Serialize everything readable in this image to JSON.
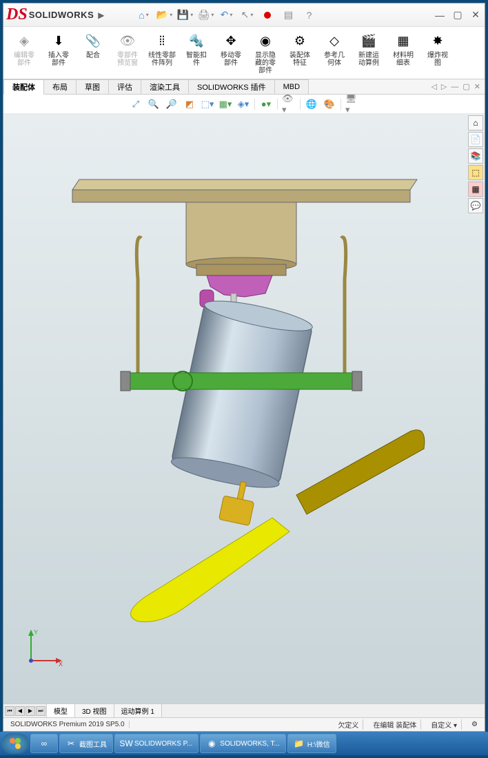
{
  "app": {
    "name": "SOLIDWORKS"
  },
  "ribbon": [
    {
      "id": "edit-part",
      "label": "编辑零\n部件",
      "disabled": true,
      "icon": "◈"
    },
    {
      "id": "insert-part",
      "label": "插入零\n部件",
      "icon": "⬇"
    },
    {
      "id": "mate",
      "label": "配合",
      "icon": "📎"
    },
    {
      "id": "preview",
      "label": "零部件\n预览窗",
      "disabled": true,
      "icon": "👁"
    },
    {
      "id": "pattern",
      "label": "线性零部\n件阵列",
      "icon": "⦙⦙"
    },
    {
      "id": "smart",
      "label": "智能扣\n件",
      "icon": "🔩"
    },
    {
      "id": "move",
      "label": "移动零\n部件",
      "icon": "✥"
    },
    {
      "id": "hide",
      "label": "显示隐\n藏的零\n部件",
      "icon": "◉"
    },
    {
      "id": "asmfeat",
      "label": "装配体\n特征",
      "icon": "⚙"
    },
    {
      "id": "refgeom",
      "label": "参考几\n何体",
      "icon": "◇"
    },
    {
      "id": "newmotion",
      "label": "新建运\n动算例",
      "icon": "🎬"
    },
    {
      "id": "bom",
      "label": "材料明\n细表",
      "icon": "▦"
    },
    {
      "id": "exploded",
      "label": "爆炸视\n图",
      "icon": "✸"
    }
  ],
  "tabs": [
    {
      "id": "assembly",
      "label": "装配体",
      "active": true
    },
    {
      "id": "layout",
      "label": "布局"
    },
    {
      "id": "sketch",
      "label": "草图"
    },
    {
      "id": "evaluate",
      "label": "评估"
    },
    {
      "id": "render",
      "label": "渲染工具"
    },
    {
      "id": "addin",
      "label": "SOLIDWORKS 插件"
    },
    {
      "id": "mbd",
      "label": "MBD"
    }
  ],
  "viewtabs": [
    {
      "id": "model",
      "label": "模型",
      "active": true
    },
    {
      "id": "3dview",
      "label": "3D 视图"
    },
    {
      "id": "motion1",
      "label": "运动算例 1"
    }
  ],
  "status": {
    "version": "SOLIDWORKS Premium 2019 SP5.0",
    "under": "欠定义",
    "editing": "在编辑 装配体",
    "custom": "自定义"
  },
  "taskbar": [
    {
      "id": "snip",
      "label": "截图工具",
      "icon": "✂"
    },
    {
      "id": "sw",
      "label": "SOLIDWORKS P...",
      "icon": "SW"
    },
    {
      "id": "swt",
      "label": "SOLIDWORKS, T...",
      "icon": "◉"
    },
    {
      "id": "wechat",
      "label": "H:\\微信",
      "icon": "📁"
    }
  ],
  "triad": {
    "x": "X",
    "y": "Y"
  },
  "chart_data": {
    "type": "3d-model",
    "description": "Mechanical assembly: ceiling-mounted propeller/fan unit",
    "parts": [
      {
        "name": "mounting-plate",
        "color": "#b8a878",
        "shape": "flat rectangular plate (top)"
      },
      {
        "name": "cylindrical-base",
        "color": "#c8b888",
        "shape": "short cylinder below plate"
      },
      {
        "name": "bracket-frame",
        "color": "#aa9955",
        "shape": "U-shaped wire frame hanging from base"
      },
      {
        "name": "hinge-bracket",
        "color": "#b84da8",
        "shape": "small purple connector"
      },
      {
        "name": "motor-body",
        "color": "#9db4c8",
        "shape": "large tilted cylinder (main body), metallic blue-gray"
      },
      {
        "name": "cross-arm",
        "color": "#4caa3a",
        "shape": "horizontal green bar with end caps"
      },
      {
        "name": "propeller-hub",
        "color": "#d8b020",
        "shape": "small gold connector at bottom of motor"
      },
      {
        "name": "propeller-blade-near",
        "color": "#e8e800",
        "shape": "bright yellow flat blade, lower-left"
      },
      {
        "name": "propeller-blade-far",
        "color": "#a89000",
        "shape": "darker blade, upper-right"
      }
    ],
    "orientation": "front-ish view, motor tilted ~15° clockwise"
  }
}
